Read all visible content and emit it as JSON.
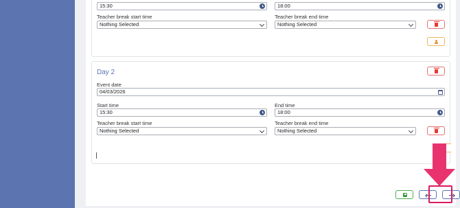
{
  "colors": {
    "sidebar": "#5c74b0",
    "accent": "#5a74b5",
    "danger": "#e53935",
    "warning": "#e39a3a",
    "success": "#3a9a3e",
    "annotation": "#e8336f"
  },
  "day1": {
    "start_time_value": "15:30",
    "end_time_value": "18:00",
    "break_start_label": "Teacher break start time",
    "break_end_label": "Teacher break end time",
    "break_start_value": "Nothing Selected",
    "break_end_value": "Nothing Selected"
  },
  "day2": {
    "title": "Day 2",
    "event_date_label": "Event date",
    "event_date_value": "04/03/2026",
    "start_time_label": "Start time",
    "start_time_value": "15:30",
    "end_time_label": "End time",
    "end_time_value": "18:00",
    "break_start_label": "Teacher break start time",
    "break_end_label": "Teacher break end time",
    "break_start_value": "Nothing Selected",
    "break_end_value": "Nothing Selected"
  },
  "icons": {
    "delete": "trash-icon",
    "teacher": "user-group-icon",
    "save": "floppy-disk-icon",
    "prev": "arrow-left-icon",
    "next": "arrow-right-icon",
    "time": "clock-icon",
    "date": "calendar-icon",
    "dropdown": "chevron-down-icon"
  }
}
